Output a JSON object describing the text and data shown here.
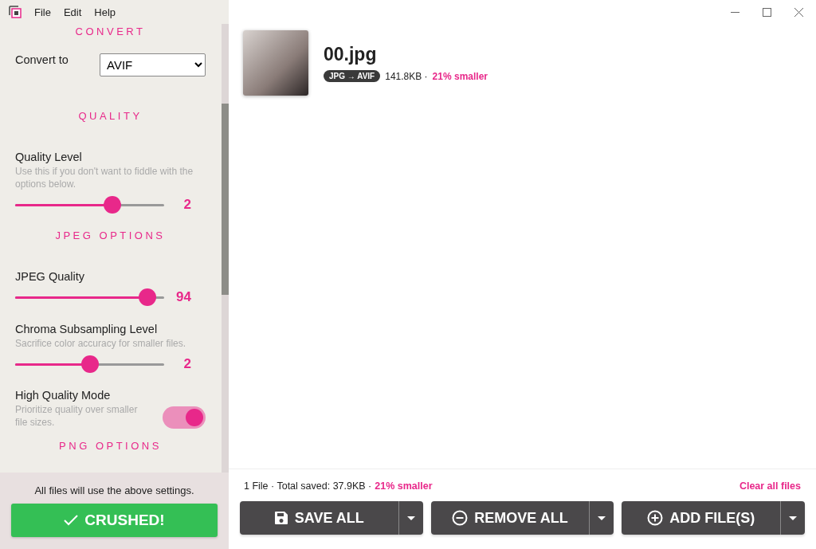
{
  "window": {
    "menu": [
      {
        "label": "File"
      },
      {
        "label": "Edit"
      },
      {
        "label": "Help"
      }
    ]
  },
  "sidebar": {
    "sections": [
      {
        "heading": "CONVERT",
        "controls": [
          {
            "kind": "select",
            "label": "Convert to",
            "value": "AVIF"
          }
        ]
      },
      {
        "heading": "QUALITY",
        "controls": [
          {
            "kind": "slider",
            "label": "Quality Level",
            "description": "Use this if you don't want to fiddle with the options below.",
            "level": 0.65,
            "reading": "2"
          }
        ]
      },
      {
        "heading": "JPEG OPTIONS",
        "controls": [
          {
            "kind": "slider",
            "label": "JPEG Quality",
            "level": 0.89,
            "reading": "94"
          },
          {
            "kind": "slider",
            "label": "Chroma Subsampling Level",
            "description": "Sacrifice color accuracy for smaller files.",
            "level": 0.5,
            "reading": "2"
          },
          {
            "kind": "toggle",
            "label": "High Quality Mode",
            "description": "Prioritize quality over smaller file sizes.",
            "on": true
          }
        ]
      },
      {
        "heading": "PNG OPTIONS"
      }
    ],
    "note": "All files will use the above settings.",
    "crush_button": {
      "label": "CRUSHED!"
    }
  },
  "files": [
    {
      "name": "00.jpg",
      "badge": "JPG → AVIF",
      "size": "141.8KB ·",
      "savings": "21% smaller"
    }
  ],
  "summary": {
    "text": "1 File · Total saved: 37.9KB ·",
    "savings": "21% smaller",
    "clear_link": "Clear all files"
  },
  "actions": [
    {
      "kind": "save",
      "label": "SAVE ALL"
    },
    {
      "kind": "remove",
      "label": "REMOVE ALL"
    },
    {
      "kind": "add",
      "label": "ADD FILE(S)"
    }
  ]
}
